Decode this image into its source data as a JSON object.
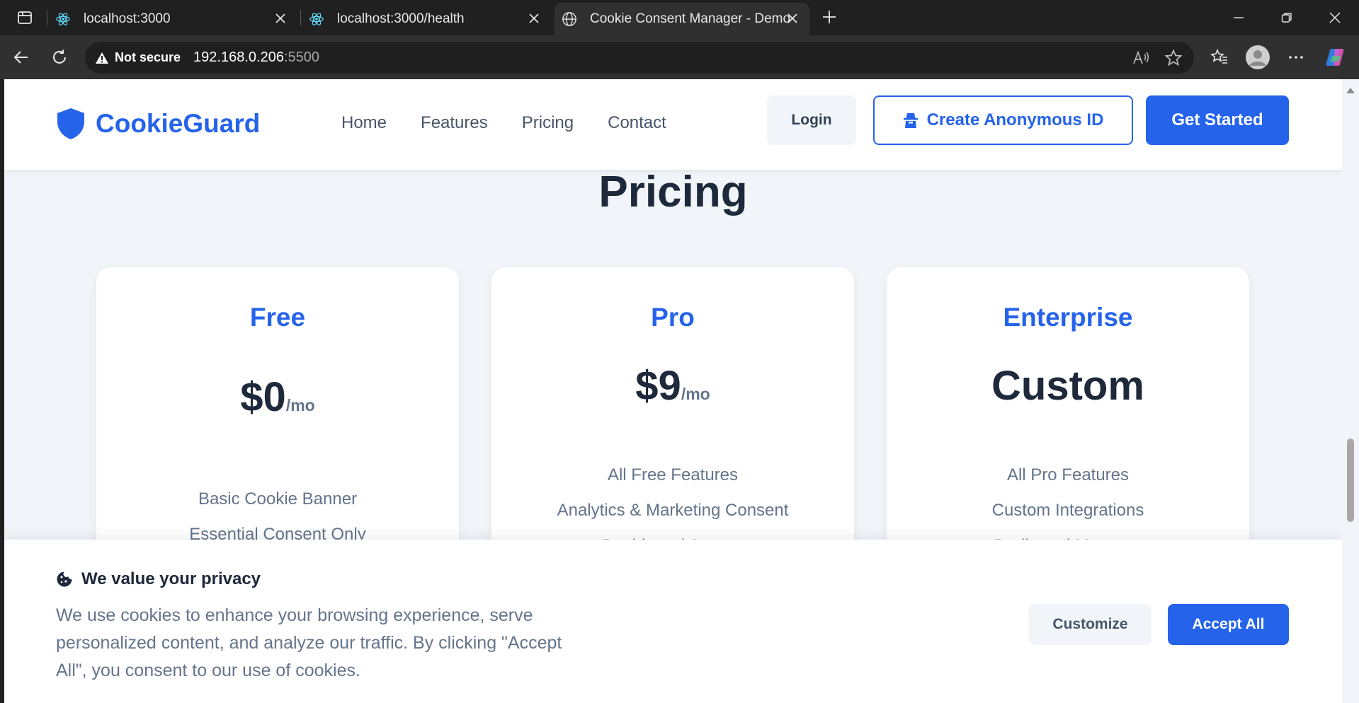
{
  "browser": {
    "tabs": [
      {
        "title": "localhost:3000"
      },
      {
        "title": "localhost:3000/health"
      },
      {
        "title": "Cookie Consent Manager - Demo"
      }
    ],
    "address": {
      "security_label": "Not secure",
      "host": "192.168.0.206",
      "port": ":5500"
    }
  },
  "site": {
    "logo_text": "CookieGuard",
    "nav": [
      "Home",
      "Features",
      "Pricing",
      "Contact"
    ],
    "login_label": "Login",
    "anon_label": "Create Anonymous ID",
    "get_started_label": "Get Started",
    "accent_color": "#2563eb"
  },
  "pricing": {
    "title": "Pricing",
    "plans": [
      {
        "name": "Free",
        "amount": "$0",
        "period": "/mo",
        "features": [
          "Basic Cookie Banner",
          "Essential Consent Only"
        ]
      },
      {
        "name": "Pro",
        "amount": "$9",
        "period": "/mo",
        "features": [
          "All Free Features",
          "Analytics & Marketing Consent",
          "Dashboard Access"
        ]
      },
      {
        "name": "Enterprise",
        "amount": "Custom",
        "period": "",
        "features": [
          "All Pro Features",
          "Custom Integrations",
          "Dedicated Manager"
        ]
      }
    ]
  },
  "cookie_banner": {
    "title": "We value your privacy",
    "text": "We use cookies to enhance your browsing experience, serve personalized content, and analyze our traffic. By clicking \"Accept All\", you consent to our use of cookies.",
    "customize_label": "Customize",
    "accept_label": "Accept All"
  }
}
